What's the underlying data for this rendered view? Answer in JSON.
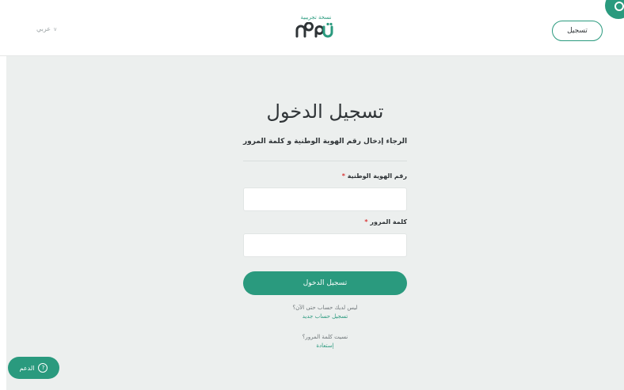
{
  "header": {
    "language_label": "عربي",
    "logo_tagline": "نسخة تجريبية",
    "signup_label": "تسجيل"
  },
  "login": {
    "title": "تسجيل الدخول",
    "subtitle": "الرجاء إدخال رقم الهوية الوطنية و كلمة المرور",
    "national_id_label": "رقم الهوية الوطنية",
    "national_id_value": "",
    "national_id_placeholder": "",
    "password_label": "كلمة المرور",
    "password_value": "",
    "password_placeholder": "",
    "required_mark": "*",
    "submit_label": "تسجيل الدخول",
    "no_account_text": "ليس لديك حساب حتى الآن؟",
    "register_link": "تسجيل حساب جديد",
    "forgot_password_text": "نسيت كلمة المرور؟",
    "recover_link": "إستعادة"
  },
  "support": {
    "label": "الدعم"
  },
  "colors": {
    "brand": "#2a9a7e",
    "page_background": "#ecefee",
    "required": "#d93a3a"
  }
}
